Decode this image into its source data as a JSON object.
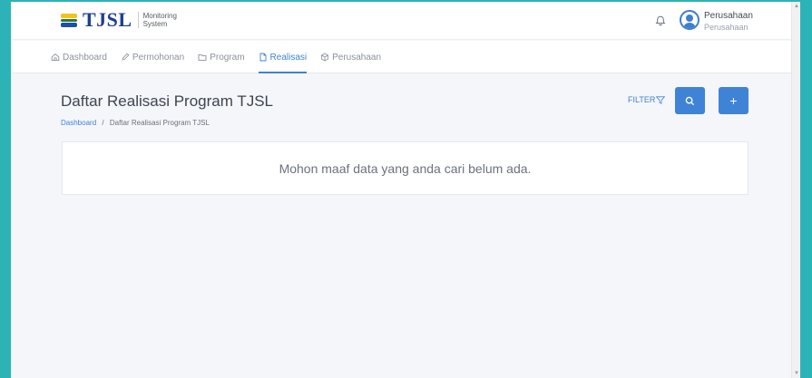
{
  "brand": {
    "name": "TJSL",
    "subtitle_line1": "Monitoring",
    "subtitle_line2": "System"
  },
  "header": {
    "notification_icon": "bell-icon",
    "user": {
      "name": "Perusahaan",
      "role": "Perusahaan",
      "avatar_icon": "user-circle-icon"
    }
  },
  "nav": {
    "items": [
      {
        "label": "Dashboard",
        "icon": "home-icon",
        "active": false
      },
      {
        "label": "Permohonan",
        "icon": "pen-icon",
        "active": false
      },
      {
        "label": "Program",
        "icon": "folder-icon",
        "active": false
      },
      {
        "label": "Realisasi",
        "icon": "file-icon",
        "active": true
      },
      {
        "label": "Perusahaan",
        "icon": "cube-icon",
        "active": false
      }
    ]
  },
  "page": {
    "title": "Daftar Realisasi Program TJSL",
    "breadcrumb": {
      "home": "Dashboard",
      "separator": "/",
      "current": "Daftar Realisasi Program TJSL"
    },
    "filter_label": "FILTER",
    "search_button_icon": "search-icon",
    "add_button_label": "+"
  },
  "empty_state": {
    "message": "Mohon maaf data yang anda cari belum ada."
  },
  "colors": {
    "accent": "#3f83d6",
    "brand": "#1d3f91",
    "frame": "#2bb3b8",
    "page_bg": "#f4f6fa"
  }
}
